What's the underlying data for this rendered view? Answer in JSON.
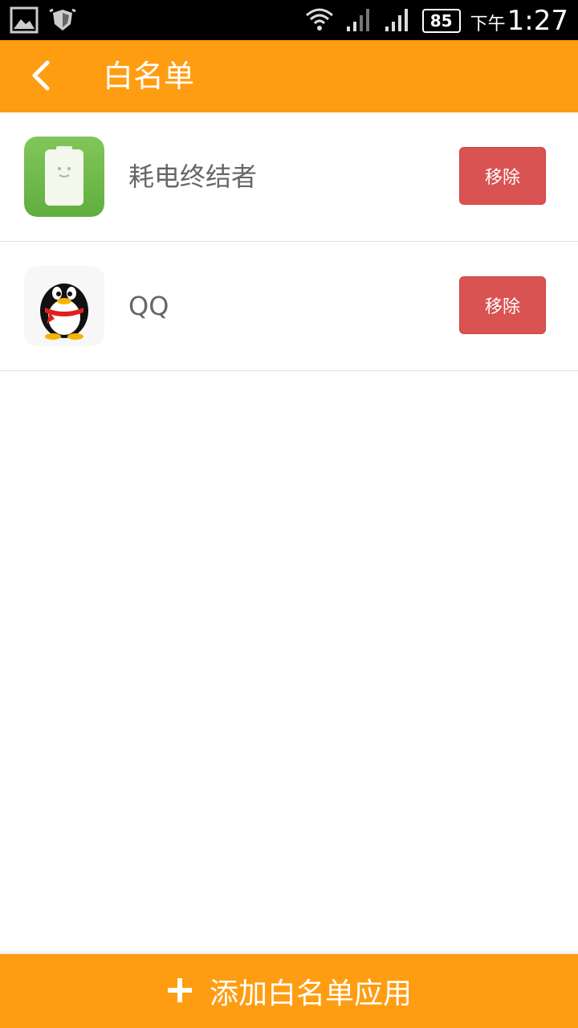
{
  "status_bar": {
    "battery_level": "85",
    "time_prefix": "下午",
    "time": "1:27",
    "icons": [
      "gallery-icon",
      "shield-icon",
      "wifi-icon",
      "signal-icon",
      "signal-icon",
      "battery-icon"
    ]
  },
  "header": {
    "title": "白名单",
    "back_icon": "chevron-left-icon"
  },
  "whitelist": {
    "items": [
      {
        "name": "耗电终结者",
        "action_label": "移除",
        "icon": "battery-app-icon"
      },
      {
        "name": "QQ",
        "action_label": "移除",
        "icon": "qq-penguin-icon"
      }
    ]
  },
  "footer": {
    "add_label": "添加白名单应用",
    "add_icon": "plus-icon"
  },
  "colors": {
    "accent": "#FF9D12",
    "remove_button": "#D95352",
    "text_secondary": "#666666"
  }
}
